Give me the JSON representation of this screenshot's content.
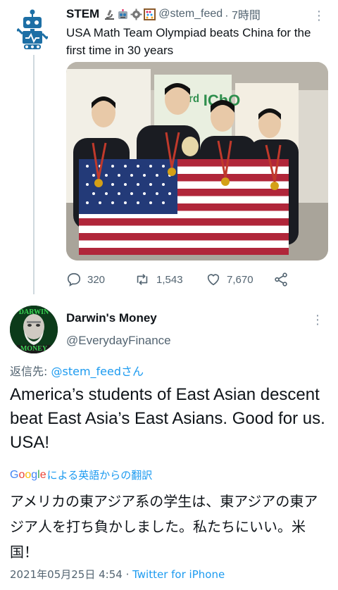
{
  "parent_tweet": {
    "author_name": "STEM",
    "author_handle": "@stem_feed",
    "time_ago": "· 7時間",
    "text": "USA Math Team Olympiad beats China for the first time in 30 years",
    "photo_banner_text": "53ʳᵈ IChO",
    "stats": {
      "replies": "320",
      "retweets": "1,543",
      "likes": "7,670"
    }
  },
  "reply_tweet": {
    "author_name": "Darwin's Money",
    "author_handle": "@EverydayFinance",
    "avatar_text_top": "DARWIN",
    "avatar_text_bottom": "MONEY",
    "reply_to_prefix": "返信先: ",
    "reply_to_mention": "@stem_feedさん",
    "text": "America’s students of East Asian descent beat East Asia’s East Asians. Good for us. USA!",
    "translation_brand": "Google",
    "translation_label": "による英語からの翻訳",
    "translated_text": "アメリカの東アジア系の学生は、東アジアの東アジア人を打ち負かしました。私たちにいい。米国！",
    "timestamp": "2021年05月25日 4:54 · ",
    "via": "Twitter for iPhone"
  },
  "colors": {
    "accent": "#1d9bf0",
    "secondary_text": "#536471",
    "primary_text": "#0f1419",
    "thread_line": "#cfd9de"
  },
  "icons": [
    "robot-avatar-icon",
    "microscope-icon",
    "robot-face-icon",
    "gear-icon",
    "abacus-icon",
    "more-icon",
    "reply-icon",
    "retweet-icon",
    "like-icon",
    "share-icon"
  ]
}
